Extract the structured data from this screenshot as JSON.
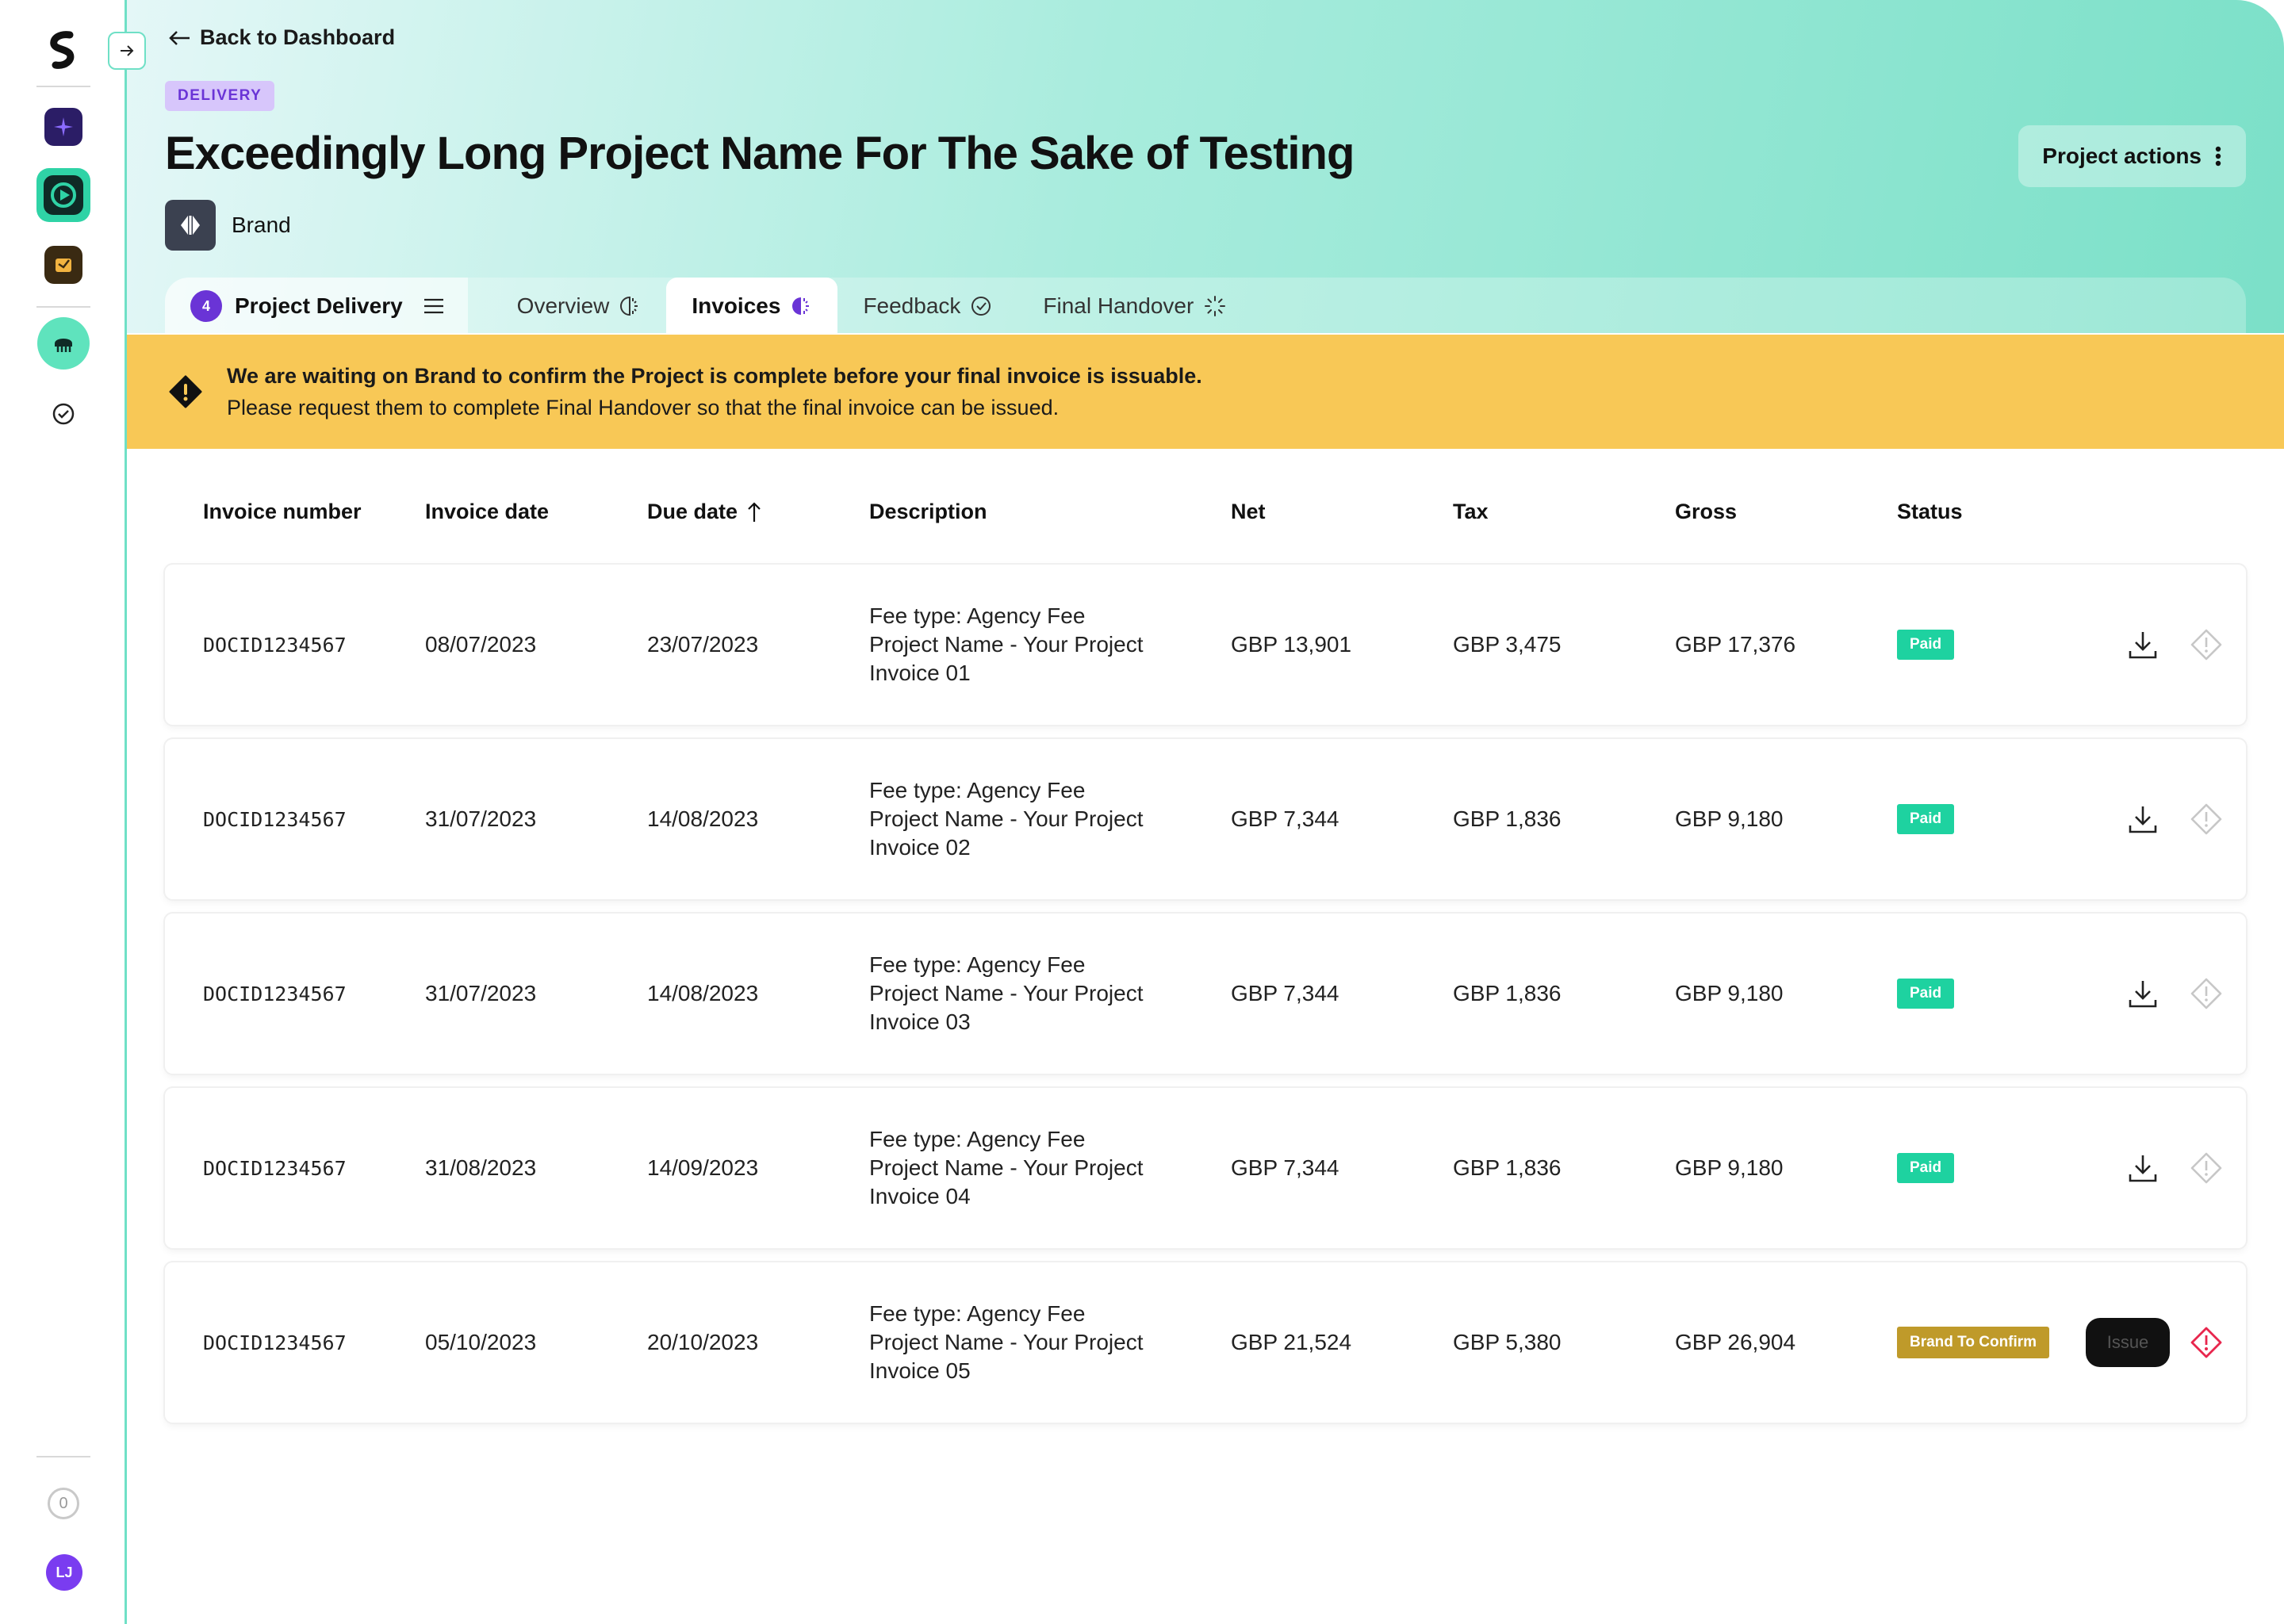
{
  "nav": {
    "back_label": "Back to Dashboard",
    "zero_count": "0",
    "avatar_initials": "LJ"
  },
  "project": {
    "badge": "DELIVERY",
    "title": "Exceedingly Long Project Name For The Sake of Testing",
    "brand": "Brand",
    "actions_label": "Project actions"
  },
  "tabs": {
    "main_count": "4",
    "main_label": "Project Delivery",
    "items": [
      "Overview",
      "Invoices",
      "Feedback",
      "Final Handover"
    ]
  },
  "banner": {
    "title": "We are waiting on Brand to confirm the Project is complete before your final invoice is issuable.",
    "body": "Please request them to complete Final Handover so that the final invoice can be issued."
  },
  "table": {
    "columns": [
      "Invoice number",
      "Invoice date",
      "Due date",
      "Description",
      "Net",
      "Tax",
      "Gross",
      "Status"
    ],
    "rows": [
      {
        "id": "DOCID1234567",
        "date": "08/07/2023",
        "due": "23/07/2023",
        "desc1": "Fee type: Agency Fee",
        "desc2": "Project Name - Your Project",
        "desc3": "Invoice 01",
        "net": "GBP 13,901",
        "tax": "GBP 3,475",
        "gross": "GBP 17,376",
        "status": "Paid"
      },
      {
        "id": "DOCID1234567",
        "date": "31/07/2023",
        "due": "14/08/2023",
        "desc1": "Fee type: Agency Fee",
        "desc2": "Project Name - Your Project",
        "desc3": "Invoice 02",
        "net": "GBP 7,344",
        "tax": "GBP 1,836",
        "gross": "GBP 9,180",
        "status": "Paid"
      },
      {
        "id": "DOCID1234567",
        "date": "31/07/2023",
        "due": "14/08/2023",
        "desc1": "Fee type: Agency Fee",
        "desc2": "Project Name - Your Project",
        "desc3": "Invoice 03",
        "net": "GBP 7,344",
        "tax": "GBP 1,836",
        "gross": "GBP 9,180",
        "status": "Paid"
      },
      {
        "id": "DOCID1234567",
        "date": "31/08/2023",
        "due": "14/09/2023",
        "desc1": "Fee type: Agency Fee",
        "desc2": "Project Name - Your Project",
        "desc3": "Invoice 04",
        "net": "GBP 7,344",
        "tax": "GBP 1,836",
        "gross": "GBP 9,180",
        "status": "Paid"
      },
      {
        "id": "DOCID1234567",
        "date": "05/10/2023",
        "due": "20/10/2023",
        "desc1": "Fee type: Agency Fee",
        "desc2": "Project Name - Your Project",
        "desc3": "Invoice 05",
        "net": "GBP 21,524",
        "tax": "GBP 5,380",
        "gross": "GBP 26,904",
        "status": "Brand To Confirm",
        "action": "Issue"
      }
    ]
  },
  "colors": {
    "accent": "#2fd3a6",
    "paid": "#1ed2a0",
    "warning": "#f8c856",
    "brand_to_confirm": "#bf9a2a",
    "purple": "#6a34d6",
    "alert_red": "#e8264d"
  },
  "icons": {
    "back": "arrow-left-icon",
    "collapse": "arrow-right-icon",
    "actions": "kebab-menu-icon",
    "warning": "alert-diamond-icon",
    "download": "download-icon",
    "report": "alert-diamond-icon"
  }
}
